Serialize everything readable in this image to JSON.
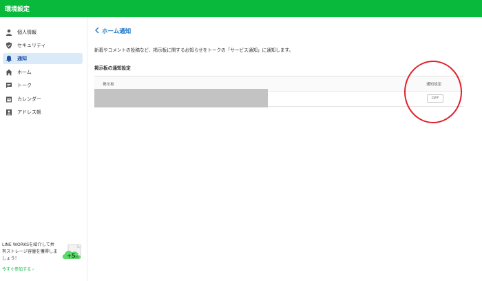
{
  "header": {
    "title": "環境設定"
  },
  "sidebar": {
    "items": [
      {
        "label": "個人情報",
        "icon": "person-icon",
        "active": false
      },
      {
        "label": "セキュリティ",
        "icon": "shield-icon",
        "active": false
      },
      {
        "label": "通知",
        "icon": "bell-icon",
        "active": true
      },
      {
        "label": "ホーム",
        "icon": "home-icon",
        "active": false
      },
      {
        "label": "トーク",
        "icon": "chat-icon",
        "active": false
      },
      {
        "label": "カレンダー",
        "icon": "calendar-icon",
        "active": false
      },
      {
        "label": "アドレス帳",
        "icon": "contact-icon",
        "active": false
      }
    ],
    "promo": {
      "text": "LINE WORKSを紹介して共有ストレージ容量を獲得しましょう！",
      "link": "今すぐ参加する",
      "badge": "+5",
      "badge_unit": "GB"
    }
  },
  "main": {
    "title": "ホーム通知",
    "description": "新着やコメントの投稿など、掲示板に関するお知らせをトークの「サービス通知」に通知します。",
    "section_title": "掲示板の通知設定",
    "table": {
      "columns": [
        "掲示板",
        "通知設定"
      ],
      "rows": [
        {
          "board": "",
          "setting": "OFF"
        }
      ]
    }
  },
  "colors": {
    "brand_green": "#08b93c",
    "accent_blue": "#1a73c8",
    "active_bg": "#dbeaf8",
    "annotation_red": "#e0202a"
  }
}
